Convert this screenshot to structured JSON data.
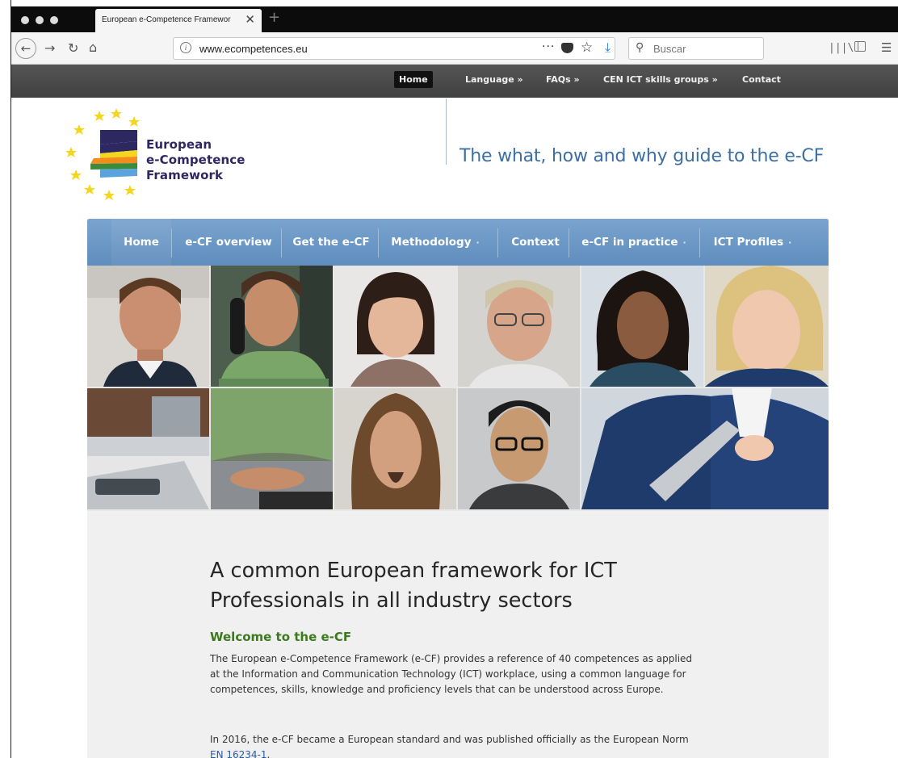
{
  "browser": {
    "tab_title": "European e-Competence Framewor",
    "tab_close": "✕",
    "new_tab": "+",
    "url": "www.ecompetences.eu",
    "url_more": "···",
    "search_placeholder": "Buscar",
    "icons": [
      "back-icon",
      "forward-icon",
      "reload-icon",
      "home-icon",
      "info-icon",
      "more-icon",
      "pocket-icon",
      "bookmark-star-icon",
      "download-icon",
      "search-icon",
      "library-icon",
      "sidebar-icon",
      "menu-icon"
    ]
  },
  "top_nav": {
    "items": [
      "Home",
      "Language »",
      "FAQs »",
      "CEN ICT skills groups »",
      "Contact"
    ]
  },
  "logo": {
    "line1": "European",
    "line2": "e-Competence",
    "line3": "Framework",
    "colors": {
      "purple": "#2e2860",
      "yellow": "#f5d51e",
      "orange": "#f28c1d",
      "green": "#3a8b3a",
      "blue": "#5aa3dc",
      "star": "#f5d51e"
    }
  },
  "tagline": "The what, how and why guide to the e-CF",
  "main_nav": {
    "items": [
      {
        "label": "Home",
        "caret": ""
      },
      {
        "label": "e-CF overview",
        "caret": ""
      },
      {
        "label": "Get the e-CF",
        "caret": ""
      },
      {
        "label": "Methodology",
        "caret": "·"
      },
      {
        "label": "Context",
        "caret": ""
      },
      {
        "label": "e-CF in practice",
        "caret": "·"
      },
      {
        "label": "ICT Profiles",
        "caret": "·"
      }
    ]
  },
  "content": {
    "headline": "A common European framework for ICT Professionals in all industry sectors",
    "welcome": "Welcome to the e-CF",
    "para1": "The European e-Competence Framework (e-CF) provides a reference of 40 competences as applied at the Information and Communication Technology (ICT) workplace, using a common language for competences, skills, knowledge and proficiency levels that can be understood across Europe.",
    "para2_text": "In 2016, the e-CF became a European standard and was published officially as the European Norm ",
    "para2_link": "EN 16234-1",
    "para2_end": "."
  }
}
